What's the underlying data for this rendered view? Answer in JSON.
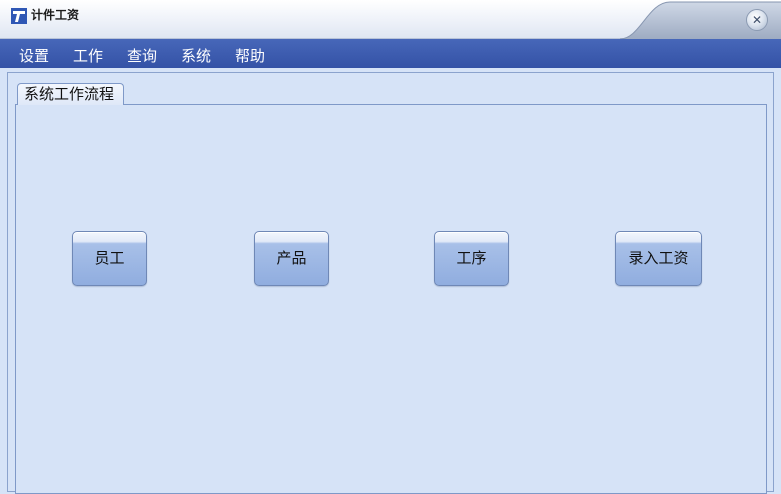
{
  "window": {
    "title": "计件工资",
    "close_icon": "close-icon"
  },
  "menu": [
    "设置",
    "工作",
    "查询",
    "系统",
    "帮助"
  ],
  "tabs": [
    {
      "label": "系统工作流程"
    }
  ],
  "flow_buttons": [
    {
      "label": "员工"
    },
    {
      "label": "产品"
    },
    {
      "label": "工序"
    },
    {
      "label": "录入工资"
    }
  ],
  "colors": {
    "menubar": "#3a58ab",
    "panel": "#d6e3f7",
    "button": "#9db8e3"
  }
}
